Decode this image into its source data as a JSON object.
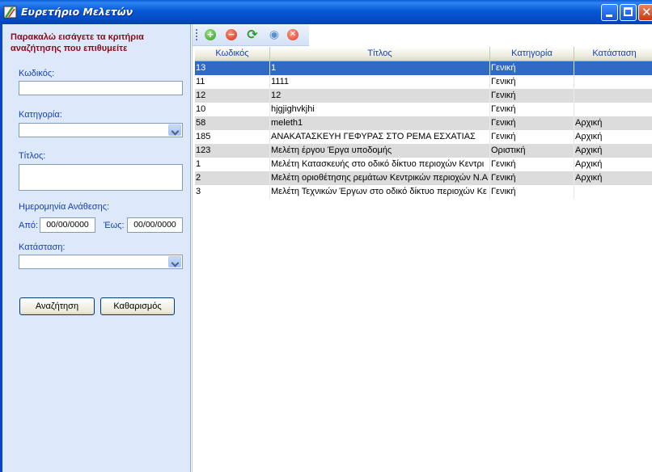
{
  "window": {
    "title": "Ευρετήριο Μελετών",
    "close_glyph": "✕"
  },
  "search": {
    "instructions": "Παρακαλώ εισάγετε τα κριτήρια αναζήτησης που επιθυμείτε",
    "code_label": "Κωδικός:",
    "code_value": "",
    "category_label": "Κατηγορία:",
    "category_value": "",
    "title_label": "Τίτλος:",
    "title_value": "",
    "date_label": "Ημερομηνία Ανάθεσης:",
    "from_label": "Από:",
    "from_value": "00/00/0000",
    "to_label": "Έως:",
    "to_value": "00/00/0000",
    "status_label": "Κατάσταση:",
    "status_value": "",
    "search_button": "Αναζήτηση",
    "clear_button": "Καθαρισμός"
  },
  "toolbar": {
    "add_icon": "add-icon",
    "delete_icon": "delete-icon",
    "refresh_icon": "refresh-icon",
    "view_icon": "view-icon",
    "close_icon": "close-icon",
    "add_glyph": "+",
    "delete_glyph": "−",
    "refresh_glyph": "⟳",
    "view_glyph": "◉",
    "close_glyph": "✕"
  },
  "table": {
    "columns": [
      "Κωδικός",
      "Τίτλος",
      "Κατηγορία",
      "Κατάσταση"
    ],
    "selected_row": 0,
    "rows": [
      [
        "13",
        "1",
        "Γενική",
        ""
      ],
      [
        "11",
        "1111",
        "Γενική",
        ""
      ],
      [
        "12",
        "12",
        "Γενική",
        ""
      ],
      [
        "10",
        "hjgjighvkjhi",
        "Γενική",
        ""
      ],
      [
        "58",
        "meleth1",
        "Γενική",
        "Αρχική"
      ],
      [
        "185",
        "ΑΝΑΚΑΤΑΣΚΕΥΗ ΓΕΦΥΡΑΣ ΣΤΟ ΡΕΜΑ ΕΣΧΑΤΙΑΣ",
        "Γενική",
        "Αρχική"
      ],
      [
        "123",
        "Μελέτη έργου Έργα υποδομής",
        "Οριστική",
        "Αρχική"
      ],
      [
        "1",
        "Μελέτη Κατασκευής στο οδικό δίκτυο περιοχών Κεντρι",
        "Γενική",
        "Αρχική"
      ],
      [
        "2",
        "Μελέτη οριοθέτησης ρεμάτων Κεντρικών περιοχών Ν.Α",
        "Γενική",
        "Αρχική"
      ],
      [
        "3",
        "Μελέτη Τεχνικών Έργων στο οδικό δίκτυο περιοχών Κε",
        "Γενική",
        ""
      ]
    ]
  },
  "colors": {
    "titlebar": "#0758d7",
    "selection": "#316ac5",
    "instructions_text": "#8a0b1a",
    "label_text": "#1540b6",
    "left_panel_bg": "#dde9fa",
    "alt_row": "#dcdcdc"
  }
}
